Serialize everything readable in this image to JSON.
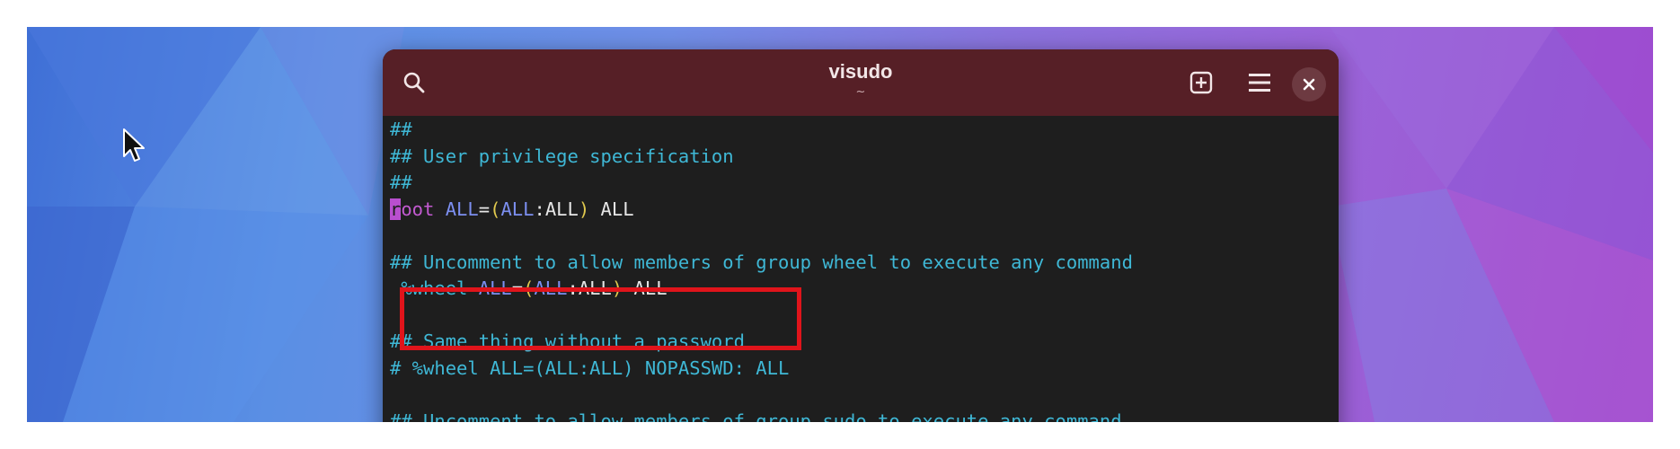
{
  "window": {
    "title": "visudo",
    "subtitle": "~"
  },
  "icons": {
    "search": "search-icon",
    "new_tab": "new-tab-icon",
    "menu": "hamburger-menu-icon",
    "close": "close-icon",
    "pointer": "mouse-pointer-icon"
  },
  "colors": {
    "titlebar": "#561f26",
    "terminal_bg": "#1e1e1e",
    "comment": "#3fb8d6",
    "highlight": "#e0141b"
  },
  "lines": {
    "l1": "##",
    "l2": "## User privilege specification",
    "l3": "##",
    "l4_cursor": "r",
    "l4_rest": "oot",
    "l4_space": " ",
    "l4_all1": "ALL",
    "l4_eq": "=",
    "l4_paren_open": "(",
    "l4_all2": "ALL",
    "l4_colon": ":",
    "l4_all3": "ALL",
    "l4_paren_close": ")",
    "l4_all4": " ALL",
    "l5": "",
    "l6": "## Uncomment to allow members of group wheel to execute any command",
    "l7_lead": " ",
    "l7_wheel": "%wheel",
    "l7_space": " ",
    "l7_all1": "ALL",
    "l7_eq": "=",
    "l7_paren_open": "(",
    "l7_all2": "ALL",
    "l7_colon": ":",
    "l7_all3": "ALL",
    "l7_paren_close": ")",
    "l7_all4": " ALL",
    "l8": "",
    "l9": "## Same thing without a password",
    "l10": "# %wheel ALL=(ALL:ALL) NOPASSWD: ALL",
    "l11": "",
    "l12": "## Uncomment to allow members of group sudo to execute any command"
  }
}
